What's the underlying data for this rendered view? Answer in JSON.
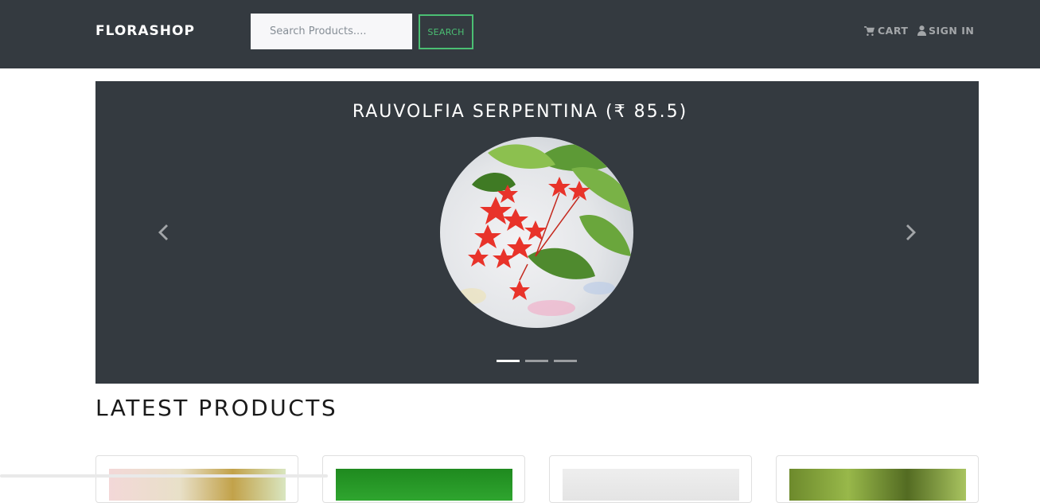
{
  "navbar": {
    "brand": "FLORASHOP",
    "search_placeholder": "Search Products....",
    "search_button": "SEARCH",
    "cart_label": "CART",
    "signin_label": "SIGN IN",
    "cart_icon": "shopping-cart-icon",
    "signin_icon": "user-icon"
  },
  "carousel": {
    "title": "RAUVOLFIA SERPENTINA (₹ 85.5)",
    "prev_icon": "chevron-left-icon",
    "next_icon": "chevron-right-icon",
    "slide_count": 3,
    "active_index": 0
  },
  "latest_products": {
    "title": "LATEST PRODUCTS",
    "card_count": 4
  },
  "colors": {
    "navbar_bg": "#343a40",
    "accent_green": "#4bbf73",
    "carousel_bg": "#343a40"
  }
}
